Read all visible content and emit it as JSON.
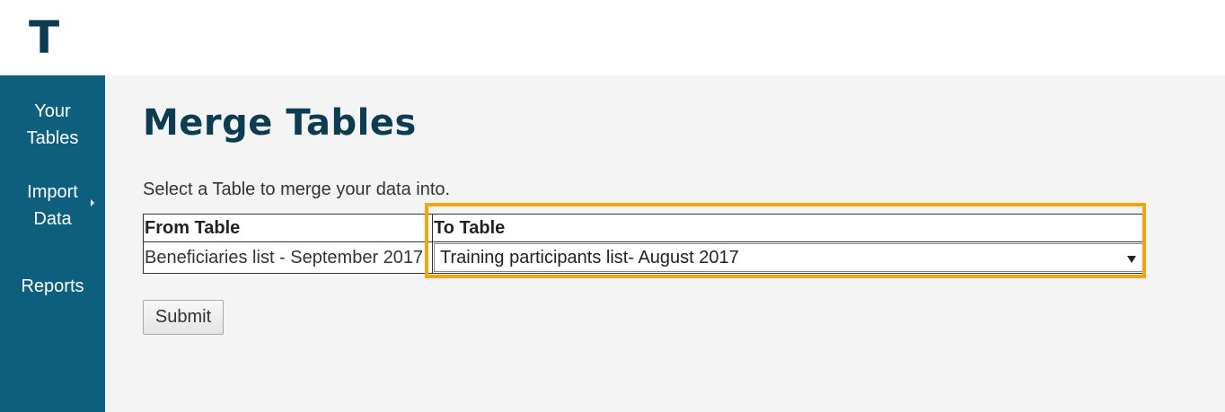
{
  "header": {
    "logo": "T"
  },
  "sidebar": {
    "items": [
      {
        "label": "Your Tables"
      },
      {
        "label": "Import Data"
      },
      {
        "label": "Reports"
      }
    ]
  },
  "main": {
    "title": "Merge Tables",
    "instruction": "Select a Table to merge your data into.",
    "table": {
      "from_header": "From Table",
      "to_header": "To Table",
      "from_value": "Beneficiaries list - September 2017",
      "to_selected": "Training participants list- August 2017"
    },
    "submit_label": "Submit"
  },
  "colors": {
    "brand_dark": "#0b3d52",
    "sidebar_bg": "#0e5f7e",
    "highlight": "#f5a40d"
  }
}
